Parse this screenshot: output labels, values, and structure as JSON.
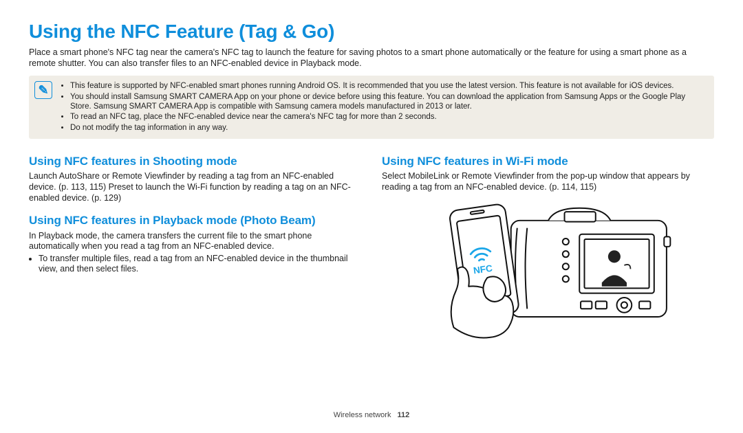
{
  "title": "Using the NFC Feature (Tag & Go)",
  "intro": "Place a smart phone's NFC tag near the camera's NFC tag to launch the feature for saving photos to a smart phone automatically or the feature for using a smart phone as a remote shutter. You can also transfer files to an NFC-enabled device in Playback mode.",
  "note_icon_glyph": "✎",
  "notes": [
    "This feature is supported by NFC-enabled smart phones running Android OS. It is recommended that you use the latest version. This feature is not available for iOS devices.",
    "You should install Samsung SMART CAMERA App on your phone or device before using this feature. You can download the application from Samsung Apps or the Google Play Store. Samsung SMART CAMERA App is compatible with Samsung camera models manufactured in 2013 or later.",
    "To read an NFC tag, place the NFC-enabled device near the camera's NFC tag for more than 2 seconds.",
    "Do not modify the tag information in any way."
  ],
  "left": {
    "sec1_title": "Using NFC features in Shooting mode",
    "sec1_body": "Launch AutoShare or Remote Viewfinder by reading a tag from an NFC-enabled device. (p. 113, 115) Preset to launch the Wi-Fi function by reading a tag on an NFC-enabled device. (p. 129)",
    "sec2_title": "Using NFC features in Playback mode (Photo Beam)",
    "sec2_body": "In Playback mode, the camera transfers the current file to the smart phone automatically when you read a tag from an NFC-enabled device.",
    "sec2_bullet": "To transfer multiple files, read a tag from an NFC-enabled device in the thumbnail view, and then select files."
  },
  "right": {
    "sec1_title": "Using NFC features in Wi-Fi mode",
    "sec1_body": "Select MobileLink or Remote Viewfinder from the pop-up window that appears by reading a tag from an NFC-enabled device. (p. 114, 115)",
    "nfc_label": "NFC"
  },
  "footer_section": "Wireless network",
  "footer_page": "112"
}
